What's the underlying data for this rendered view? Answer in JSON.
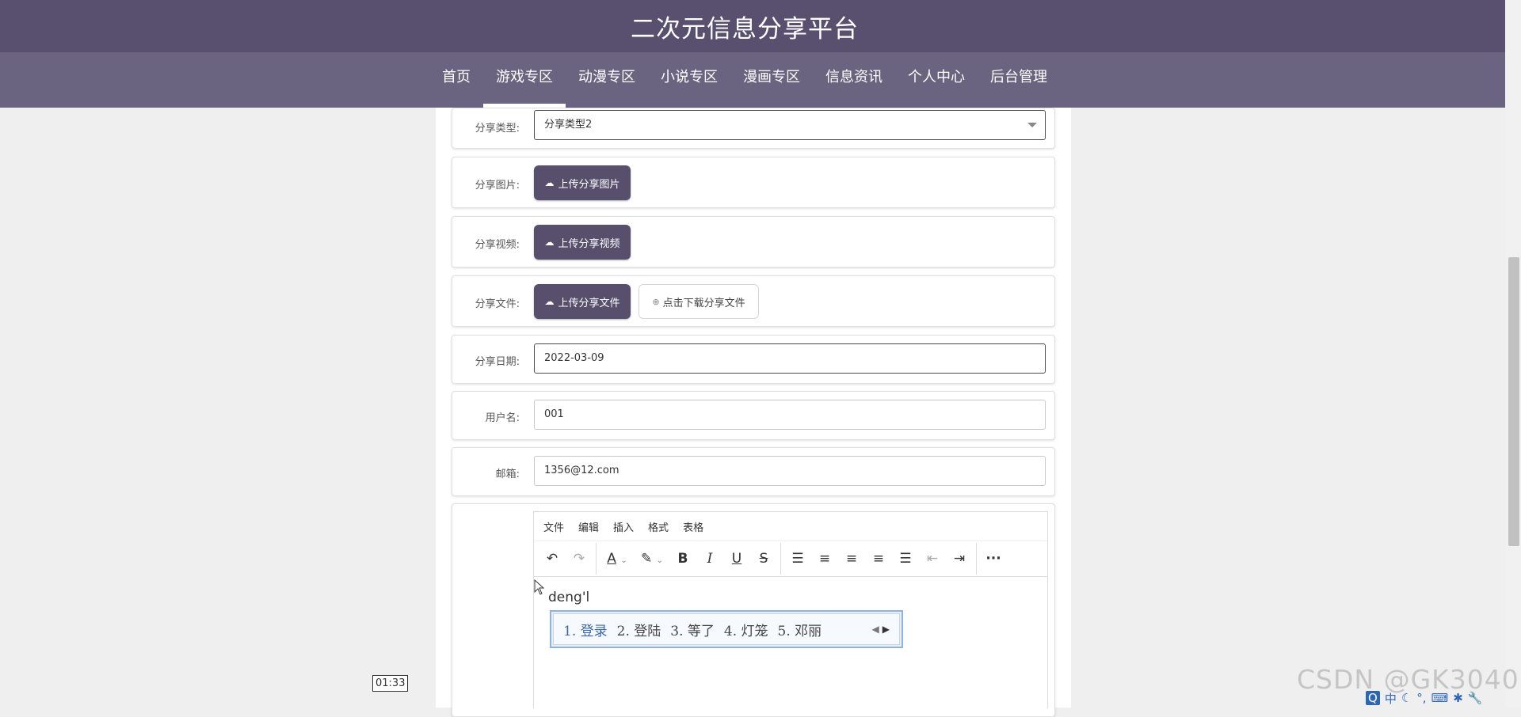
{
  "header": {
    "title": "二次元信息分享平台"
  },
  "nav": {
    "items": [
      {
        "label": "首页"
      },
      {
        "label": "游戏专区"
      },
      {
        "label": "动漫专区"
      },
      {
        "label": "小说专区"
      },
      {
        "label": "漫画专区"
      },
      {
        "label": "信息资讯"
      },
      {
        "label": "个人中心"
      },
      {
        "label": "后台管理"
      }
    ],
    "active": "游戏专区"
  },
  "form": {
    "share_type": {
      "label": "分享类型:",
      "value": "分享类型2"
    },
    "share_image": {
      "label": "分享图片:",
      "button": "上传分享图片"
    },
    "share_video": {
      "label": "分享视频:",
      "button": "上传分享视频"
    },
    "share_file": {
      "label": "分享文件:",
      "button": "上传分享文件",
      "download": "点击下载分享文件"
    },
    "share_date": {
      "label": "分享日期:",
      "value": "2022-03-09"
    },
    "username": {
      "label": "用户名:",
      "value": "001"
    },
    "email": {
      "label": "邮箱:",
      "value": "1356@12.com"
    }
  },
  "editor": {
    "menu": [
      "文件",
      "编辑",
      "插入",
      "格式",
      "表格"
    ],
    "content": "deng'l"
  },
  "ime": {
    "candidates": [
      "1. 登录",
      "2. 登陆",
      "3. 等了",
      "4. 灯笼",
      "5. 邓丽"
    ]
  },
  "overlay": {
    "timer": "01:33",
    "watermark": "CSDN @GK3040"
  },
  "tray": {
    "lang": "中"
  }
}
